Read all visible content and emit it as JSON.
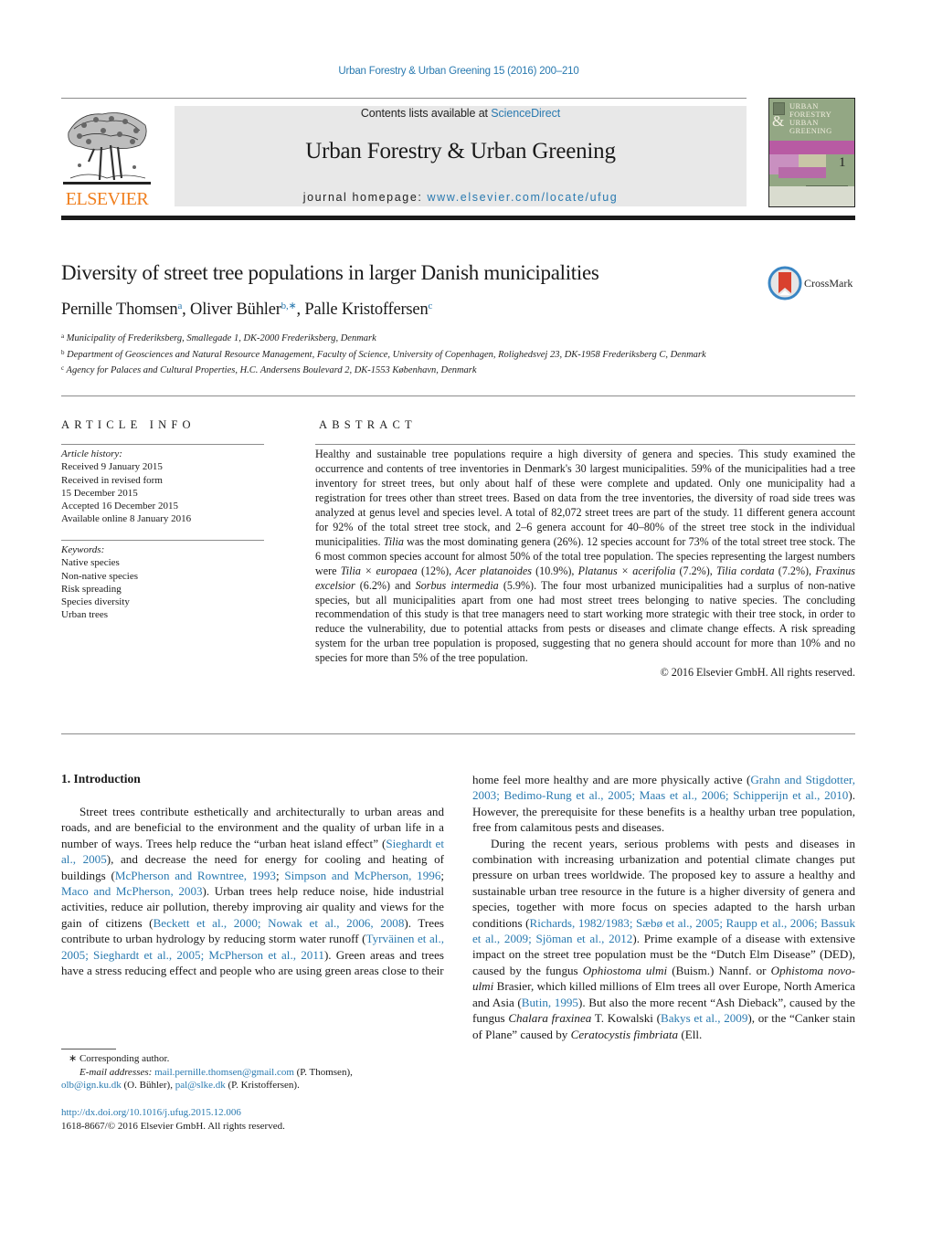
{
  "journal_ref": "Urban Forestry & Urban Greening 15 (2016) 200–210",
  "masthead": {
    "contents_prefix": "Contents lists available at ",
    "contents_link": "ScienceDirect",
    "journal_name": "Urban Forestry & Urban Greening",
    "homepage_prefix": "journal homepage: ",
    "homepage_link": "www.elsevier.com/locate/ufug",
    "publisher_logo_text": "ELSEVIER",
    "cover": {
      "title_lines": [
        "URBAN",
        "FORESTRY",
        "URBAN",
        "GREENING"
      ],
      "amp": "&",
      "issue_number": "1"
    }
  },
  "colors": {
    "link": "#2a7ab0",
    "elsevier_orange": "#f07f1e",
    "masthead_bg": "#e8e8e8",
    "crossmark_red": "#d9412e",
    "crossmark_ring": "#3a86c4"
  },
  "article": {
    "title": "Diversity of street tree populations in larger Danish municipalities",
    "crossmark_label": "CrossMark",
    "authors": [
      {
        "name": "Pernille Thomsen",
        "sup": "a"
      },
      {
        "name": "Oliver Bühler",
        "sup": "b,∗"
      },
      {
        "name": "Palle Kristoffersen",
        "sup": "c"
      }
    ],
    "affiliations": [
      {
        "sup": "a",
        "text": "Municipality of Frederiksberg, Smallegade 1, DK-2000 Frederiksberg, Denmark"
      },
      {
        "sup": "b",
        "text": "Department of Geosciences and Natural Resource Management, Faculty of Science, University of Copenhagen, Rolighedsvej 23, DK-1958 Frederiksberg C, Denmark"
      },
      {
        "sup": "c",
        "text": "Agency for Palaces and Cultural Properties, H.C. Andersens Boulevard 2, DK-1553 København, Denmark"
      }
    ]
  },
  "article_info": {
    "heading": "ARTICLE INFO",
    "history_label": "Article history:",
    "history": [
      "Received 9 January 2015",
      "Received in revised form",
      "15 December 2015",
      "Accepted 16 December 2015",
      "Available online 8 January 2016"
    ],
    "keywords_label": "Keywords:",
    "keywords": [
      "Native species",
      "Non-native species",
      "Risk spreading",
      "Species diversity",
      "Urban trees"
    ]
  },
  "abstract": {
    "heading": "ABSTRACT",
    "segments": [
      {
        "t": "Healthy and sustainable tree populations require a high diversity of genera and species. This study examined the occurrence and contents of tree inventories in Denmark's 30 largest municipalities. 59% of the municipalities had a tree inventory for street trees, but only about half of these were complete and updated. Only one municipality had a registration for trees other than street trees. Based on data from the tree inventories, the diversity of road side trees was analyzed at genus level and species level. A total of 82,072 street trees are part of the study. 11 different genera account for 92% of the total street tree stock, and 2–6 genera account for 40–80% of the street tree stock in the individual municipalities. "
      },
      {
        "i": "Tilia"
      },
      {
        "t": " was the most dominating genera (26%). 12 species account for 73% of the total street tree stock. The 6 most common species account for almost 50% of the total tree population. The species representing the largest numbers were "
      },
      {
        "i": "Tilia × europaea"
      },
      {
        "t": " (12%), "
      },
      {
        "i": "Acer platanoides"
      },
      {
        "t": " (10.9%), "
      },
      {
        "i": "Platanus × acerifolia"
      },
      {
        "t": " (7.2%), "
      },
      {
        "i": "Tilia cordata"
      },
      {
        "t": " (7.2%), "
      },
      {
        "i": "Fraxinus excelsior"
      },
      {
        "t": " (6.2%) and "
      },
      {
        "i": "Sorbus intermedia"
      },
      {
        "t": " (5.9%). The four most urbanized municipalities had a surplus of non-native species, but all municipalities apart from one had most street trees belonging to native species. The concluding recommendation of this study is that tree managers need to start working more strategic with their tree stock, in order to reduce the vulnerability, due to potential attacks from pests or diseases and climate change effects. A risk spreading system for the urban tree population is proposed, suggesting that no genera should account for more than 10% and no species for more than 5% of the tree population."
      }
    ],
    "copyright": "© 2016 Elsevier GmbH. All rights reserved."
  },
  "introduction": {
    "heading": "1.  Introduction",
    "left_paragraph": [
      {
        "t": "Street trees contribute esthetically and architecturally to urban areas and roads, and are beneficial to the environment and the quality of urban life in a number of ways. Trees help reduce the “urban heat island effect” ("
      },
      {
        "l": "Sieghardt et al., 2005"
      },
      {
        "t": "), and decrease the need for energy for cooling and heating of buildings ("
      },
      {
        "l": "McPherson and Rowntree, 1993"
      },
      {
        "t": "; "
      },
      {
        "l": "Simpson and McPherson, 1996"
      },
      {
        "t": "; "
      },
      {
        "l": "Maco and McPherson, 2003"
      },
      {
        "t": "). Urban trees help reduce noise, hide industrial activities, reduce air pollution, thereby improving air quality and views for the gain of citizens ("
      },
      {
        "l": "Beckett et al., 2000; Nowak et al., 2006, 2008"
      },
      {
        "t": "). Trees contribute to urban hydrology by reducing storm water runoff ("
      },
      {
        "l": "Tyrväinen et al., 2005; Sieghardt et al., 2005; McPherson et al., 2011"
      },
      {
        "t": "). Green areas and trees have a stress reducing effect and people who are using green areas close to their"
      }
    ],
    "right_paragraph_1": [
      {
        "t": "home feel more healthy and are more physically active ("
      },
      {
        "l": "Grahn and Stigdotter, 2003; Bedimo-Rung et al., 2005; Maas et al., 2006; Schipperijn et al., 2010"
      },
      {
        "t": "). However, the prerequisite for these benefits is a healthy urban tree population, free from calamitous pests and diseases."
      }
    ],
    "right_paragraph_2": [
      {
        "t": "During the recent years, serious problems with pests and diseases in combination with increasing urbanization and potential climate changes put pressure on urban trees worldwide. The proposed key to assure a healthy and sustainable urban tree resource in the future is a higher diversity of genera and species, together with more focus on species adapted to the harsh urban conditions ("
      },
      {
        "l": "Richards, 1982/1983; Sæbø et al., 2005; Raupp et al., 2006; Bassuk et al., 2009; Sjöman et al., 2012"
      },
      {
        "t": "). Prime example of a disease with extensive impact on the street tree population must be the “Dutch Elm Disease” (DED), caused by the fungus "
      },
      {
        "i": "Ophiostoma ulmi"
      },
      {
        "t": " (Buism.) Nannf. or "
      },
      {
        "i": "Ophistoma novo-ulmi"
      },
      {
        "t": " Brasier, which killed millions of Elm trees all over Europe, North America and Asia ("
      },
      {
        "l": "Butin, 1995"
      },
      {
        "t": "). But also the more recent “Ash Dieback”, caused by the fungus "
      },
      {
        "i": "Chalara fraxinea"
      },
      {
        "t": " T. Kowalski ("
      },
      {
        "l": "Bakys et al., 2009"
      },
      {
        "t": "), or the “Canker stain of Plane” caused by "
      },
      {
        "i": "Ceratocystis fimbriata"
      },
      {
        "t": " (Ell."
      }
    ]
  },
  "footnotes": {
    "corresponding": "∗  Corresponding author.",
    "email_label": "E-mail addresses:",
    "emails": [
      {
        "address": "mail.pernille.thomsen@gmail.com",
        "who": " (P. Thomsen),"
      },
      {
        "address": "olb@ign.ku.dk",
        "who": " (O. Bühler), "
      },
      {
        "address": "pal@slke.dk",
        "who": " (P. Kristoffersen)."
      }
    ],
    "doi": "http://dx.doi.org/10.1016/j.ufug.2015.12.006",
    "issn_copyright": "1618-8667/© 2016 Elsevier GmbH. All rights reserved."
  }
}
